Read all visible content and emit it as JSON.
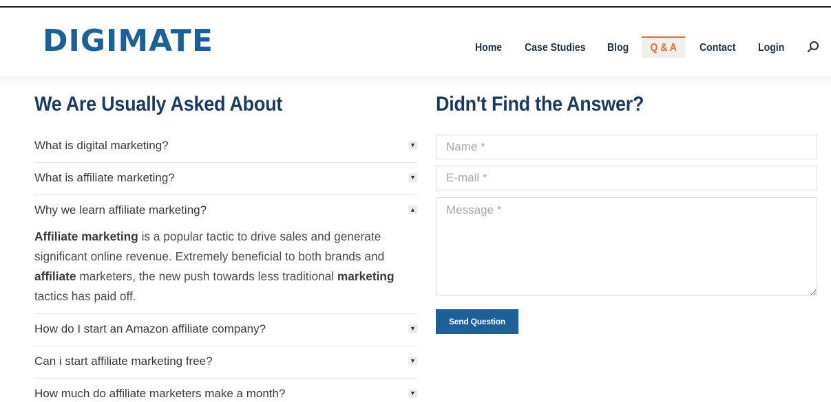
{
  "brand": {
    "logo_text": "DIGIMATE",
    "primary_color": "#1d5f96",
    "accent_color": "#e0703a"
  },
  "nav": {
    "items": [
      {
        "label": "Home",
        "active": false
      },
      {
        "label": "Case Studies",
        "active": false
      },
      {
        "label": "Blog",
        "active": false
      },
      {
        "label": "Q & A",
        "active": true
      },
      {
        "label": "Contact",
        "active": false
      },
      {
        "label": "Login",
        "active": false
      }
    ],
    "search_icon": "search-icon"
  },
  "faq": {
    "title": "We Are Usually Asked About",
    "items": [
      {
        "question": "What is digital marketing?",
        "expanded": false
      },
      {
        "question": "What is affiliate marketing?",
        "expanded": false
      },
      {
        "question": "Why we learn affiliate marketing?",
        "expanded": true,
        "answer": {
          "bold_1": "Affiliate marketing",
          "text_1": " is a popular tactic to drive sales and generate significant online revenue. Extremely beneficial to both brands and ",
          "bold_2": "affiliate",
          "text_2": " marketers, the new push towards less traditional ",
          "bold_3": "marketing",
          "text_3": " tactics has paid off."
        }
      },
      {
        "question": "How do I start an Amazon affiliate company?",
        "expanded": false
      },
      {
        "question": "Can i start affiliate marketing free?",
        "expanded": false
      },
      {
        "question": "How much do affiliate marketers make a month?",
        "expanded": false
      }
    ]
  },
  "contact_form": {
    "title": "Didn't Find the Answer?",
    "name_placeholder": "Name *",
    "email_placeholder": "E-mail *",
    "message_placeholder": "Message *",
    "submit_label": "Send Question"
  }
}
